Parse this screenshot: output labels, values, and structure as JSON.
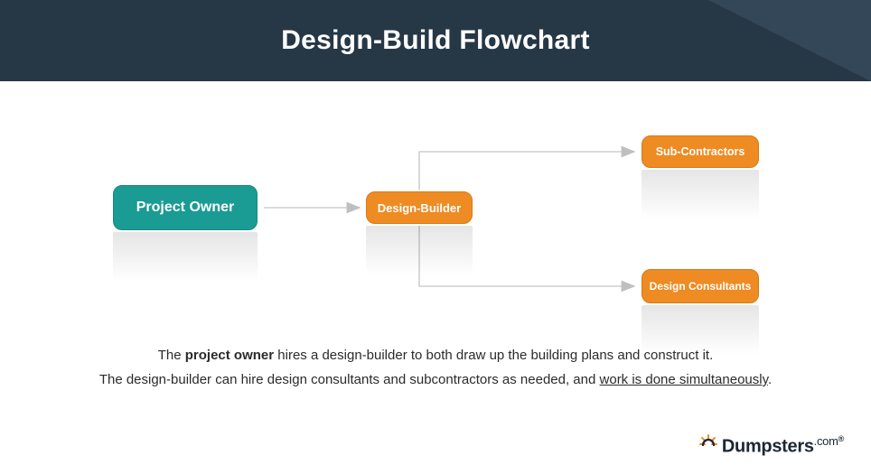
{
  "header": {
    "title": "Design-Build Flowchart"
  },
  "nodes": {
    "project_owner": "Project Owner",
    "design_builder": "Design-Builder",
    "sub_contractors": "Sub-Contractors",
    "design_consultants": "Design Consultants"
  },
  "caption": {
    "line1_a": "The ",
    "line1_b": "project owner",
    "line1_c": " hires a design-builder to both draw up the building plans and construct it.",
    "line2_a": "The design-builder can hire design consultants and subcontractors as needed, and ",
    "line2_b": "work is done simultaneously",
    "line2_c": "."
  },
  "logo": {
    "brand": "Dumpsters",
    "suffix": ".com",
    "mark": "®"
  },
  "colors": {
    "header_bg": "#263746",
    "teal": "#1a9b93",
    "orange": "#ee8b23",
    "arrow": "#cfcfcf"
  }
}
